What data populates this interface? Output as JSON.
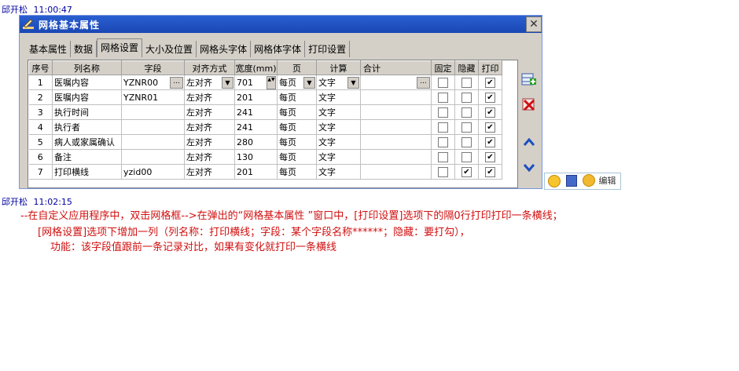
{
  "messages": [
    {
      "name": "邱开松",
      "time": "11:00:47"
    },
    {
      "name": "邱开松",
      "time": "11:02:15"
    }
  ],
  "dialog": {
    "title": "网格基本属性",
    "tabs": [
      "基本属性",
      "数据",
      "网格设置",
      "大小及位置",
      "网格头字体",
      "网格体字体",
      "打印设置"
    ],
    "active_tab": "网格设置",
    "columns": [
      "序号",
      "列名称",
      "字段",
      "对齐方式",
      "宽度(mm)",
      "页",
      "计算",
      "合计",
      "固定",
      "隐藏",
      "打印"
    ],
    "rows": [
      {
        "no": "1",
        "name": "医嘱内容",
        "field": "YZNR00",
        "align": "左对齐",
        "width": "701",
        "page": "每页",
        "calc": "文字",
        "fixed": false,
        "hidden": false,
        "print": true
      },
      {
        "no": "2",
        "name": "医嘱内容",
        "field": "YZNR01",
        "align": "左对齐",
        "width": "201",
        "page": "每页",
        "calc": "文字",
        "fixed": false,
        "hidden": false,
        "print": true
      },
      {
        "no": "3",
        "name": "执行时间",
        "field": "",
        "align": "左对齐",
        "width": "241",
        "page": "每页",
        "calc": "文字",
        "fixed": false,
        "hidden": false,
        "print": true
      },
      {
        "no": "4",
        "name": "执行者",
        "field": "",
        "align": "左对齐",
        "width": "241",
        "page": "每页",
        "calc": "文字",
        "fixed": false,
        "hidden": false,
        "print": true
      },
      {
        "no": "5",
        "name": "病人或家属确认",
        "field": "",
        "align": "左对齐",
        "width": "280",
        "page": "每页",
        "calc": "文字",
        "fixed": false,
        "hidden": false,
        "print": true
      },
      {
        "no": "6",
        "name": "备注",
        "field": "",
        "align": "左对齐",
        "width": "130",
        "page": "每页",
        "calc": "文字",
        "fixed": false,
        "hidden": false,
        "print": true
      },
      {
        "no": "7",
        "name": "打印横线",
        "field": "yzid00",
        "align": "左对齐",
        "width": "201",
        "page": "每页",
        "calc": "文字",
        "fixed": false,
        "hidden": true,
        "print": true
      }
    ],
    "side_buttons": [
      "add-row-icon",
      "delete-row-icon",
      "move-up-icon",
      "move-down-icon"
    ],
    "close_label": "✕"
  },
  "chat_toolbar": {
    "edit_label": "编辑"
  },
  "note_lines": [
    "--在自定义应用程序中，双击网格框-->在弹出的“网格基本属性 ”窗口中，[打印设置]选项下的隔0行打印打印一条横线；",
    "[网格设置]选项下增加一列（列名称：打印横线；字段：某个字段名称******；隐藏：要打勾），",
    "功能：该字段值跟前一条记录对比，如果有变化就打印一条横线"
  ],
  "colors": {
    "note": "#d01010",
    "titlebar": "#1a47b4",
    "name": "#0000a0"
  }
}
